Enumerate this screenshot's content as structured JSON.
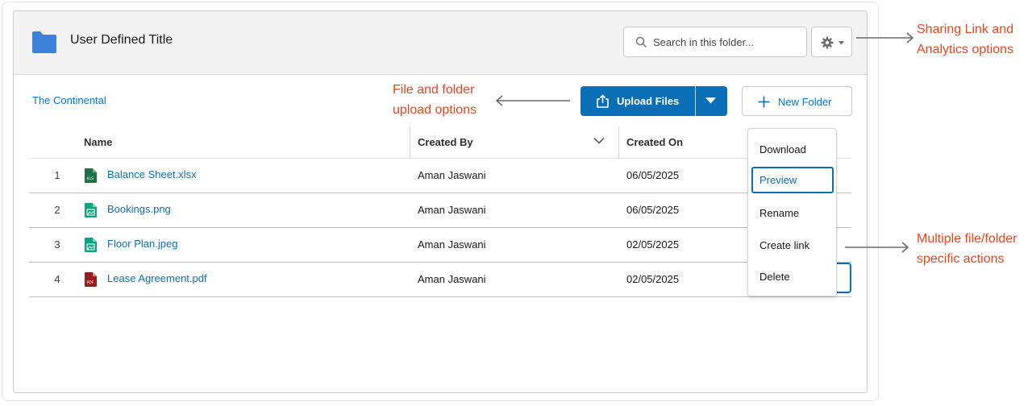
{
  "header": {
    "title": "User Defined Title",
    "search_placeholder": "Search in this folder..."
  },
  "icons": {
    "folder": "folder-icon",
    "search": "search-icon",
    "settings": "gear-icon",
    "upload": "upload-icon",
    "add": "plus-icon"
  },
  "breadcrumb": "The Continental",
  "toolbar": {
    "upload_label": "Upload Files",
    "new_folder_label": "New Folder"
  },
  "table": {
    "columns": [
      "Name",
      "Created By",
      "Created On"
    ],
    "rows": [
      {
        "index": "1",
        "name": "Balance Sheet.xlsx",
        "type": "xlsx",
        "created_by": "Aman Jaswani",
        "created_on": "06/05/2025"
      },
      {
        "index": "2",
        "name": "Bookings.png",
        "type": "image",
        "created_by": "Aman Jaswani",
        "created_on": "06/05/2025"
      },
      {
        "index": "3",
        "name": "Floor Plan.jpeg",
        "type": "image",
        "created_by": "Aman Jaswani",
        "created_on": "02/05/2025"
      },
      {
        "index": "4",
        "name": "Lease Agreement.pdf",
        "type": "pdf",
        "created_by": "Aman Jaswani",
        "created_on": "02/05/2025"
      }
    ]
  },
  "row_menu": {
    "items": [
      "Download",
      "Preview",
      "Rename",
      "Create link",
      "Delete"
    ],
    "highlighted": "Preview"
  },
  "annotations": {
    "sharing_line1": "Sharing Link and",
    "sharing_line2": "Analytics options",
    "upload_line1": "File and folder",
    "upload_line2": "upload options",
    "actions_line1": "Multiple file/folder",
    "actions_line2": "specific actions"
  },
  "colors": {
    "brand_blue": "#0b6fb8",
    "link_blue": "#0176d3",
    "annotation_red": "#e8451f",
    "xlsx_green": "#1e7145",
    "image_teal": "#0fa37f",
    "pdf_red": "#9b1c1c"
  }
}
